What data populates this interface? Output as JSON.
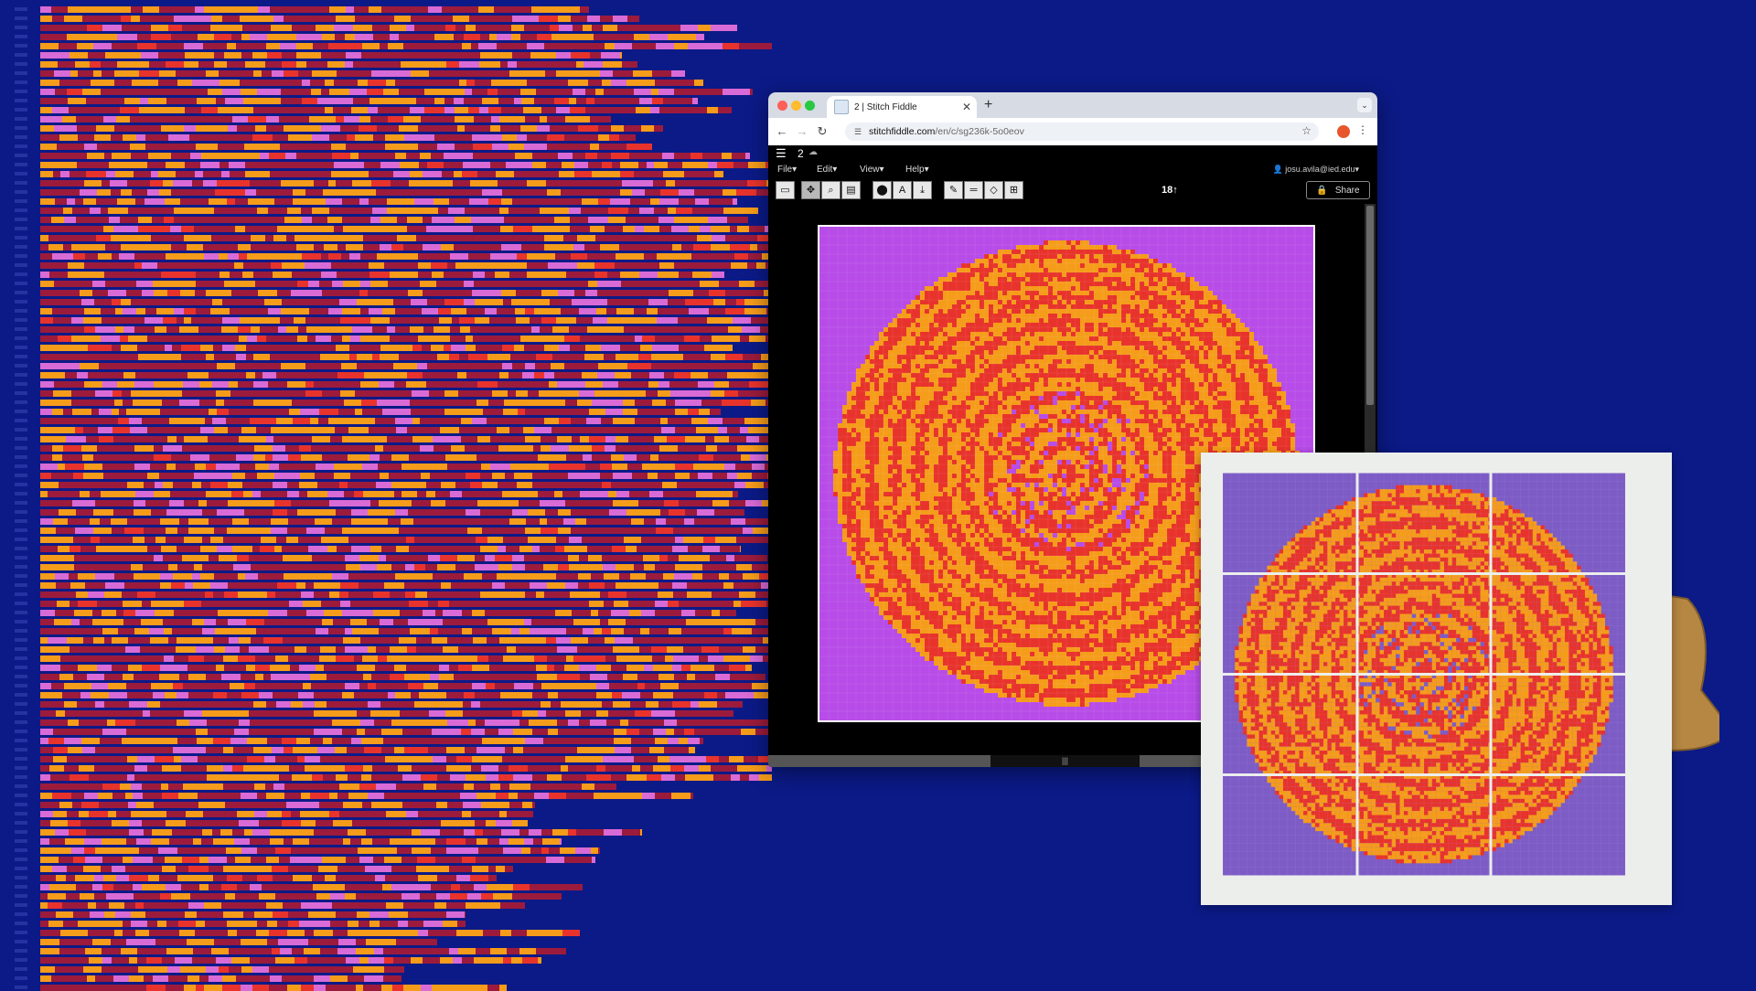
{
  "browser": {
    "tab_title": "2 | Stitch Fiddle",
    "favicon_text": "Stitch Fiddle",
    "url_domain": "stitchfiddle.com",
    "url_path": "/en/c/sg236k-5o0eov",
    "new_tab_icon": "plus-icon",
    "close_tab_icon": "close-icon"
  },
  "app": {
    "doc_name": "2",
    "menus": [
      "File",
      "Edit",
      "View",
      "Help"
    ],
    "user_email": "josu.avila@ied.edu",
    "zoom_label": "18",
    "share_label": "Share",
    "tools": [
      "folder-icon",
      "move-icon",
      "search-icon",
      "panel-icon",
      "marker-icon",
      "text-icon",
      "download-icon",
      "pencil-icon",
      "line-icon",
      "eraser-icon",
      "grid-icon"
    ]
  },
  "colors": {
    "background": "#0b1a87",
    "red": "#e8332c",
    "orange": "#f59c1a",
    "purple": "#b74ce8",
    "paper_purple": "#7d5cc6",
    "dark_red": "#9c1b3c",
    "light_purple": "#d96bd6"
  }
}
